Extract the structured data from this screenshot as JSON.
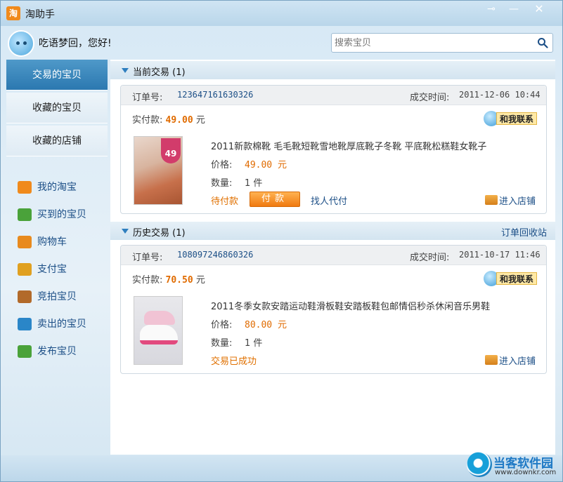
{
  "app": {
    "title": "淘助手",
    "icon_char": "淘"
  },
  "window_controls": {
    "pin": "⊸",
    "minimize": "—",
    "close": "✕"
  },
  "user": {
    "greeting": "吃语梦回，您好!"
  },
  "search": {
    "placeholder": "搜索宝贝"
  },
  "sidebar": {
    "tabs": [
      {
        "label": "交易的宝贝",
        "active": true
      },
      {
        "label": "收藏的宝贝",
        "active": false
      },
      {
        "label": "收藏的店铺",
        "active": false
      }
    ],
    "links": [
      {
        "label": "我的淘宝",
        "icon": "taobao-icon",
        "color": "#f08a1c"
      },
      {
        "label": "买到的宝贝",
        "icon": "bought-icon",
        "color": "#4aa23a"
      },
      {
        "label": "购物车",
        "icon": "cart-icon",
        "color": "#e88a1e"
      },
      {
        "label": "支付宝",
        "icon": "alipay-icon",
        "color": "#e0a020"
      },
      {
        "label": "竞拍宝贝",
        "icon": "auction-icon",
        "color": "#b26a2a"
      },
      {
        "label": "卖出的宝贝",
        "icon": "sold-icon",
        "color": "#2a86c8"
      },
      {
        "label": "发布宝贝",
        "icon": "publish-icon",
        "color": "#4aa23a"
      }
    ]
  },
  "current": {
    "header": "当前交易 (1)",
    "order": {
      "order_label": "订单号:",
      "order_no": "123647161630326",
      "time_label": "成交时间:",
      "time": "2011-12-06 10:44",
      "paid_label": "实付款:",
      "paid_amount": "49.00",
      "paid_unit": "元",
      "contact": "和我联系",
      "thumb_tag": "49",
      "title": "2011新款棉靴 毛毛靴短靴雪地靴厚底靴子冬靴 平底靴松糕鞋女靴子",
      "price_label": "价格:",
      "price": "49.00 元",
      "qty_label": "数量:",
      "qty": "1 件",
      "status": "待付款",
      "pay_button": "付款",
      "proxy": "找人代付",
      "store": "进入店铺"
    }
  },
  "history": {
    "header": "历史交易 (1)",
    "recycle": "订单回收站",
    "order": {
      "order_label": "订单号:",
      "order_no": "108097246860326",
      "time_label": "成交时间:",
      "time": "2011-10-17 11:46",
      "paid_label": "实付款:",
      "paid_amount": "70.50",
      "paid_unit": "元",
      "contact": "和我联系",
      "title": "2011冬季女款安踏运动鞋滑板鞋安踏板鞋包邮情侣秒杀休闲音乐男鞋",
      "price_label": "价格:",
      "price": "80.00 元",
      "qty_label": "数量:",
      "qty": "1 件",
      "status": "交易已成功",
      "store": "进入店铺"
    }
  },
  "watermark": {
    "text": "当客软件园",
    "url": "www.downkr.com"
  }
}
